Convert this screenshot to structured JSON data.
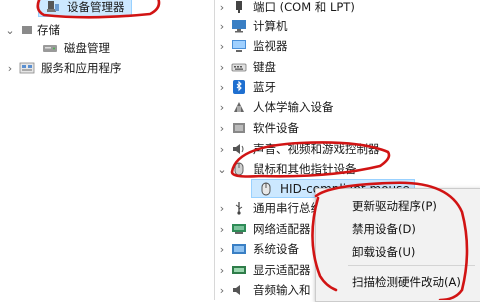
{
  "left_tree": {
    "items": [
      {
        "label": "设备管理器",
        "icon": "device-manager-icon"
      },
      {
        "label": "存储",
        "icon": "",
        "chevron": "⌄"
      },
      {
        "label": "磁盘管理",
        "icon": "disk-icon"
      },
      {
        "label": "服务和应用程序",
        "icon": "services-icon",
        "chevron": "›"
      }
    ]
  },
  "device_tree": {
    "categories": [
      {
        "label": "端口 (COM 和 LPT)",
        "icon": "port-icon"
      },
      {
        "label": "计算机",
        "icon": "computer-icon"
      },
      {
        "label": "监视器",
        "icon": "monitor-icon"
      },
      {
        "label": "键盘",
        "icon": "keyboard-icon"
      },
      {
        "label": "蓝牙",
        "icon": "bluetooth-icon"
      },
      {
        "label": "人体学输入设备",
        "icon": "hid-icon"
      },
      {
        "label": "软件设备",
        "icon": "software-device-icon"
      },
      {
        "label": "声音、视频和游戏控制器",
        "icon": "speaker-icon"
      },
      {
        "label": "鼠标和其他指针设备",
        "icon": "mouse-icon",
        "expanded": true
      },
      {
        "label": "通用串行总线",
        "icon": "usb-icon"
      },
      {
        "label": "网络适配器",
        "icon": "network-icon"
      },
      {
        "label": "系统设备",
        "icon": "system-icon"
      },
      {
        "label": "显示适配器",
        "icon": "display-adapter-icon"
      },
      {
        "label": "音频输入和",
        "icon": "audio-icon"
      }
    ],
    "selected_device": {
      "label": "HID-compliant mouse",
      "icon": "mouse-icon"
    }
  },
  "context_menu": {
    "items": [
      "更新驱动程序(P)",
      "禁用设备(D)",
      "卸载设备(U)",
      "扫描检测硬件改动(A)"
    ]
  },
  "colors": {
    "annotation": "#d11414",
    "selection": "#cce8ff"
  }
}
